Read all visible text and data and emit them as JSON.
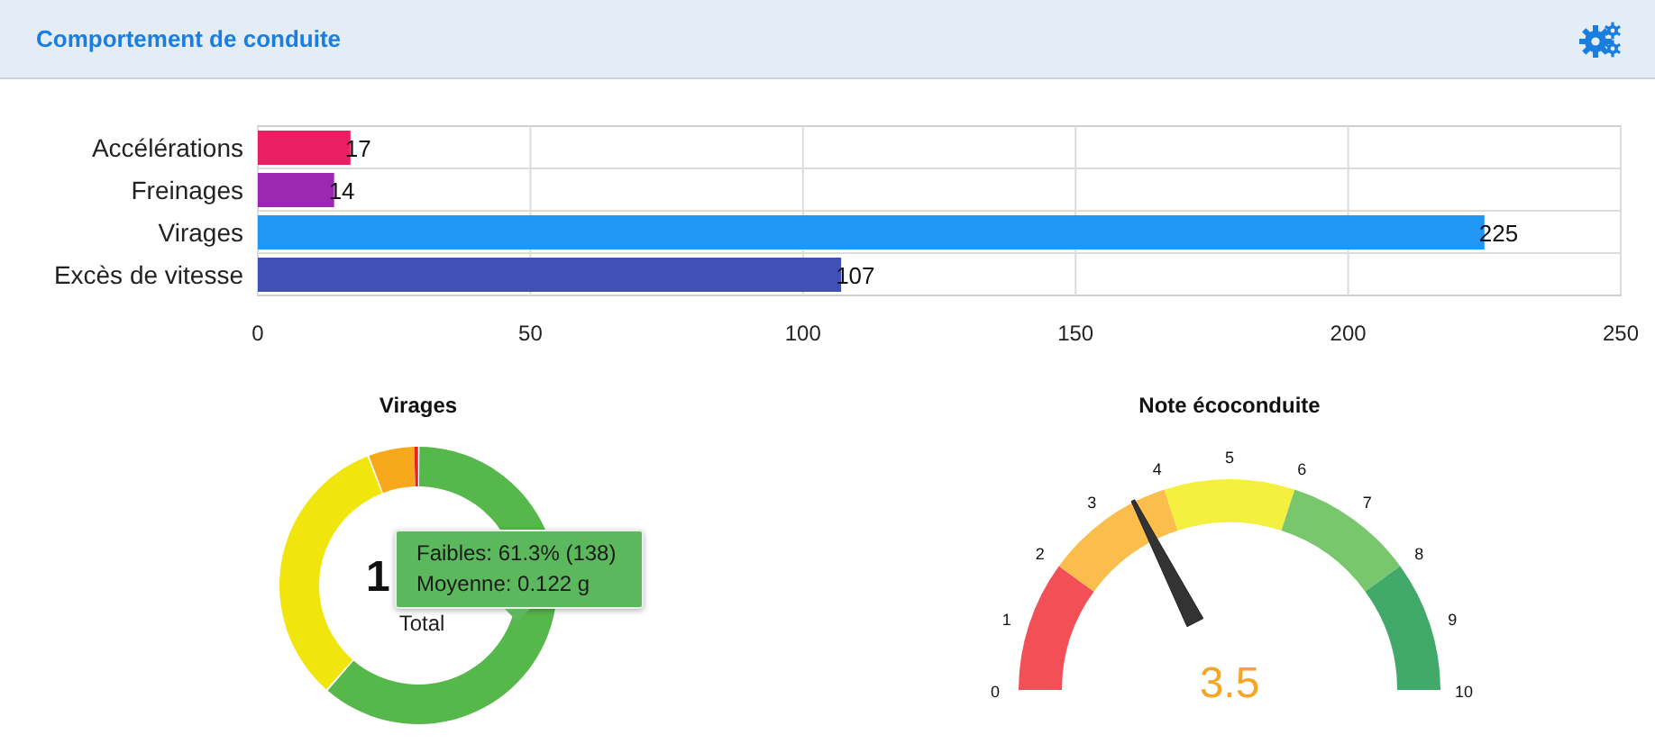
{
  "header": {
    "title": "Comportement de conduite"
  },
  "behavior_chart": {
    "chart_data": {
      "type": "bar",
      "orientation": "horizontal",
      "categories": [
        "Accélérations",
        "Freinages",
        "Virages",
        "Excès de vitesse"
      ],
      "series": [
        {
          "color": "#e91e63",
          "values": [
            17,
            null,
            null,
            null
          ]
        },
        {
          "color": "#9c27b0",
          "values": [
            null,
            14,
            null,
            null
          ]
        },
        {
          "color": "#2196f3",
          "values": [
            null,
            null,
            225,
            null
          ]
        },
        {
          "color": "#3f51b5",
          "values": [
            null,
            null,
            null,
            107
          ]
        }
      ],
      "stacked": true,
      "xlim": [
        0,
        250
      ],
      "xticks": [
        0,
        50,
        100,
        150,
        200,
        250
      ],
      "data_labels": true,
      "grid": true
    }
  },
  "turns_donut": {
    "title": "Virages",
    "center_value": "1",
    "center_label": "Total",
    "tooltip": {
      "lines": [
        "Faibles: 61.3% (138)",
        "Moyenne: 0.122 g"
      ]
    }
  },
  "eco_gauge": {
    "title": "Note écoconduite",
    "value": "3.5",
    "level": 0.35,
    "scale": [
      "0",
      "1",
      "2",
      "3",
      "4",
      "5",
      "6",
      "7",
      "8",
      "9",
      "10"
    ]
  }
}
